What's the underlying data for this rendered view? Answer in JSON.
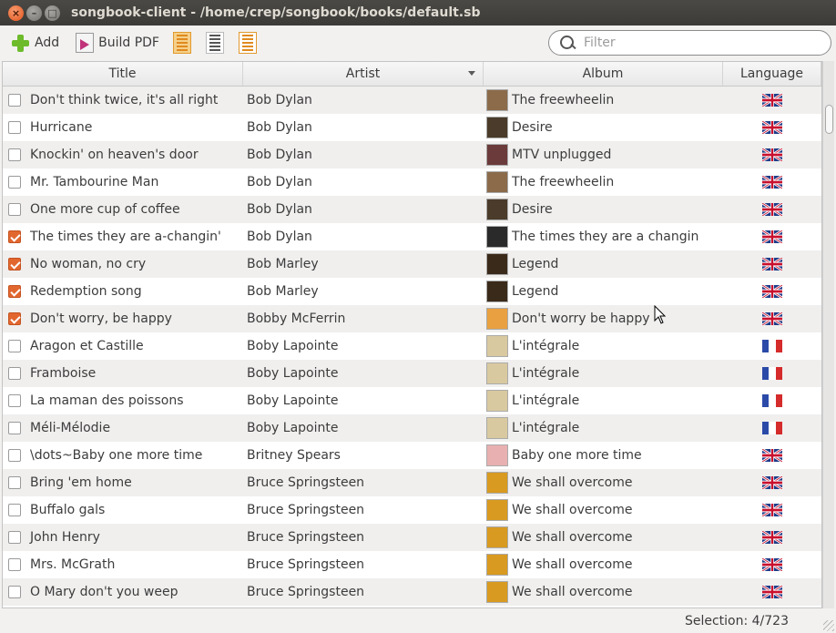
{
  "window": {
    "title": "songbook-client - /home/crep/songbook/books/default.sb",
    "close_glyph": "×",
    "min_glyph": "–",
    "max_glyph": "□"
  },
  "toolbar": {
    "add_label": "Add",
    "build_pdf_label": "Build PDF",
    "icons": [
      "add-icon",
      "pdf-icon",
      "check-all-icon",
      "list-icon",
      "uncheck-icon"
    ]
  },
  "search": {
    "placeholder": "Filter",
    "value": ""
  },
  "columns": {
    "title": "Title",
    "artist": "Artist",
    "album": "Album",
    "language": "Language"
  },
  "colors": {
    "accent": "#e2672f",
    "titlebar": "#3c3b37",
    "row_alt": "#f0efee"
  },
  "rows": [
    {
      "checked": false,
      "title": "Don't think twice, it's all right",
      "artist": "Bob Dylan",
      "album": "The freewheelin",
      "cover": "#8b6b4a",
      "lang": "en"
    },
    {
      "checked": false,
      "title": "Hurricane",
      "artist": "Bob Dylan",
      "album": "Desire",
      "cover": "#4a3b2a",
      "lang": "en"
    },
    {
      "checked": false,
      "title": "Knockin' on heaven's door",
      "artist": "Bob Dylan",
      "album": "MTV unplugged",
      "cover": "#6b3a3a",
      "lang": "en"
    },
    {
      "checked": false,
      "title": "Mr. Tambourine Man",
      "artist": "Bob Dylan",
      "album": "The freewheelin",
      "cover": "#8b6b4a",
      "lang": "en"
    },
    {
      "checked": false,
      "title": "One more cup of coffee",
      "artist": "Bob Dylan",
      "album": "Desire",
      "cover": "#4a3b2a",
      "lang": "en"
    },
    {
      "checked": true,
      "title": "The times they are a-changin'",
      "artist": "Bob Dylan",
      "album": "The times they are a changin",
      "cover": "#2a2a2a",
      "lang": "en"
    },
    {
      "checked": true,
      "title": "No woman, no cry",
      "artist": "Bob Marley",
      "album": "Legend",
      "cover": "#3a2a1a",
      "lang": "en"
    },
    {
      "checked": true,
      "title": "Redemption song",
      "artist": "Bob Marley",
      "album": "Legend",
      "cover": "#3a2a1a",
      "lang": "en"
    },
    {
      "checked": true,
      "title": "Don't worry, be happy",
      "artist": "Bobby McFerrin",
      "album": "Don't worry be happy",
      "cover": "#e8a040",
      "lang": "en"
    },
    {
      "checked": false,
      "title": "Aragon et Castille",
      "artist": "Boby Lapointe",
      "album": "L'intégrale",
      "cover": "#d9c9a0",
      "lang": "fr"
    },
    {
      "checked": false,
      "title": "Framboise",
      "artist": "Boby Lapointe",
      "album": "L'intégrale",
      "cover": "#d9c9a0",
      "lang": "fr"
    },
    {
      "checked": false,
      "title": "La maman des poissons",
      "artist": "Boby Lapointe",
      "album": "L'intégrale",
      "cover": "#d9c9a0",
      "lang": "fr"
    },
    {
      "checked": false,
      "title": "Méli-Mélodie",
      "artist": "Boby Lapointe",
      "album": "L'intégrale",
      "cover": "#d9c9a0",
      "lang": "fr"
    },
    {
      "checked": false,
      "title": "\\dots~Baby one more time",
      "artist": "Britney Spears",
      "album": "Baby one more time",
      "cover": "#e8b0b0",
      "lang": "en"
    },
    {
      "checked": false,
      "title": "Bring 'em home",
      "artist": "Bruce Springsteen",
      "album": "We shall overcome",
      "cover": "#d89a20",
      "lang": "en"
    },
    {
      "checked": false,
      "title": "Buffalo gals",
      "artist": "Bruce Springsteen",
      "album": "We shall overcome",
      "cover": "#d89a20",
      "lang": "en"
    },
    {
      "checked": false,
      "title": "John Henry",
      "artist": "Bruce Springsteen",
      "album": "We shall overcome",
      "cover": "#d89a20",
      "lang": "en"
    },
    {
      "checked": false,
      "title": "Mrs. McGrath",
      "artist": "Bruce Springsteen",
      "album": "We shall overcome",
      "cover": "#d89a20",
      "lang": "en"
    },
    {
      "checked": false,
      "title": "O Mary don't you weep",
      "artist": "Bruce Springsteen",
      "album": "We shall overcome",
      "cover": "#d89a20",
      "lang": "en"
    },
    {
      "checked": false,
      "title": "",
      "artist": "",
      "album": "",
      "cover": "#d89a20",
      "lang": "en"
    }
  ],
  "status": {
    "selection": "Selection: 4/723"
  }
}
